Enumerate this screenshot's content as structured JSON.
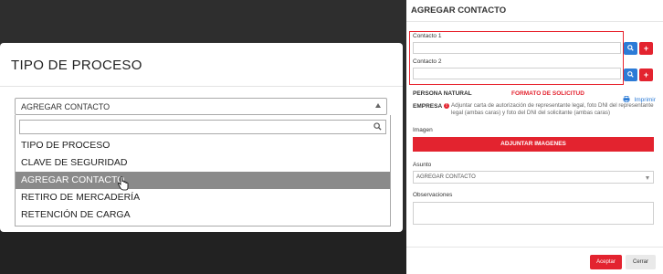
{
  "left_modal": {
    "title": "TIPO DE PROCESO",
    "selected_value": "AGREGAR CONTACTO",
    "search_placeholder": "",
    "options": [
      "TIPO DE PROCESO",
      "CLAVE DE SEGURIDAD",
      "AGREGAR CONTACTO",
      "RETIRO DE MERCADERÍA",
      "RETENCIÓN DE CARGA"
    ],
    "highlighted_index": 2
  },
  "right_panel": {
    "title": "AGREGAR CONTACTO",
    "contacto1_label": "Contacto 1",
    "contacto2_label": "Contacto 2",
    "persona_natural_label": "PERSONA NATURAL",
    "formato_label": "FORMATO DE SOLICITUD",
    "imprimir_label": "Imprimir",
    "empresa_label": "EMPRESA",
    "empresa_note": "Adjuntar carta de autorización de representante legal, foto DNI del representante legal (ambas caras) y foto del DNI del solicitante (ambas caras)",
    "imagen_label": "Imagen",
    "adjuntar_button": "ADJUNTAR IMAGENES",
    "asunto_label": "Asunto",
    "asunto_value": "AGREGAR CONTACTO",
    "observaciones_label": "Observaciones",
    "aceptar_button": "Aceptar",
    "cerrar_button": "Cerrar"
  },
  "colors": {
    "accent_red": "#e3232f",
    "accent_blue": "#2c7bd6",
    "highlight_gray": "#8a8a8a"
  }
}
